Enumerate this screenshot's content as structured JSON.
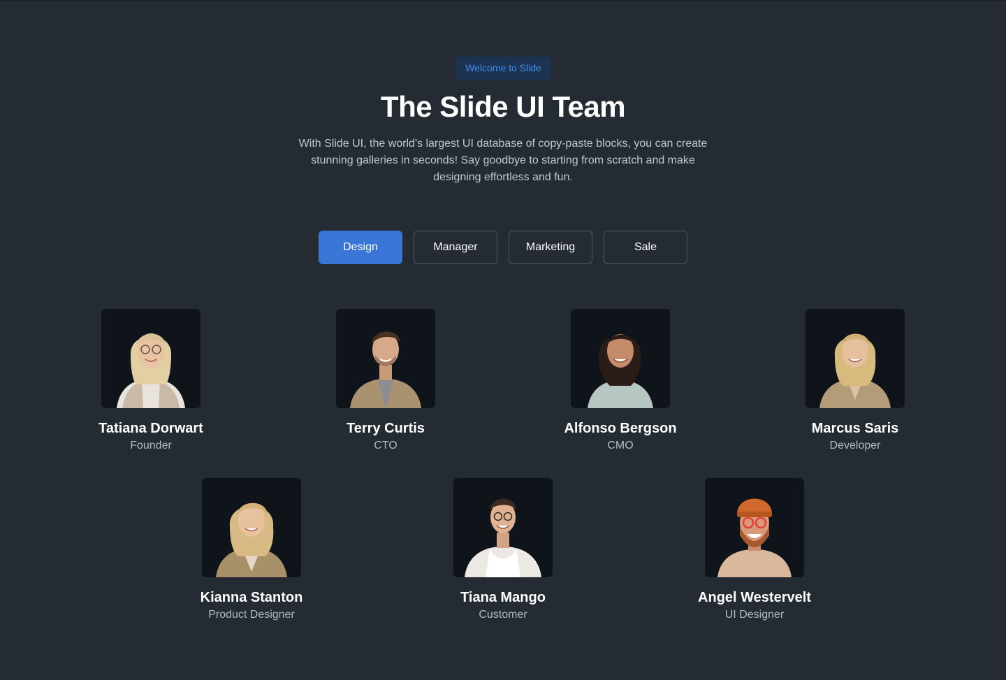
{
  "hero": {
    "badge": "Welcome to Slide",
    "title": "The Slide UI Team",
    "description_lines": [
      "With Slide UI, the world's largest UI database of copy-paste blocks, you can create",
      "stunning galleries in seconds! Say goodbye to starting from scratch and make",
      "designing effortless and fun."
    ]
  },
  "tabs": [
    {
      "label": "Design",
      "active": true
    },
    {
      "label": "Manager",
      "active": false
    },
    {
      "label": "Marketing",
      "active": false
    },
    {
      "label": "Sale",
      "active": false
    }
  ],
  "team": [
    {
      "name": "Tatiana Dorwart",
      "role": "Founder"
    },
    {
      "name": "Terry Curtis",
      "role": "CTO"
    },
    {
      "name": "Alfonso Bergson",
      "role": "CMO"
    },
    {
      "name": "Marcus Saris",
      "role": "Developer"
    },
    {
      "name": "Kianna Stanton",
      "role": "Product Designer"
    },
    {
      "name": "Tiana Mango",
      "role": "Customer"
    },
    {
      "name": "Angel Westervelt",
      "role": "UI Designer"
    }
  ],
  "colors": {
    "background": "#252b33",
    "accent": "#3a76d8",
    "badge_bg": "#1c3352",
    "badge_text": "#3f8cf0"
  }
}
